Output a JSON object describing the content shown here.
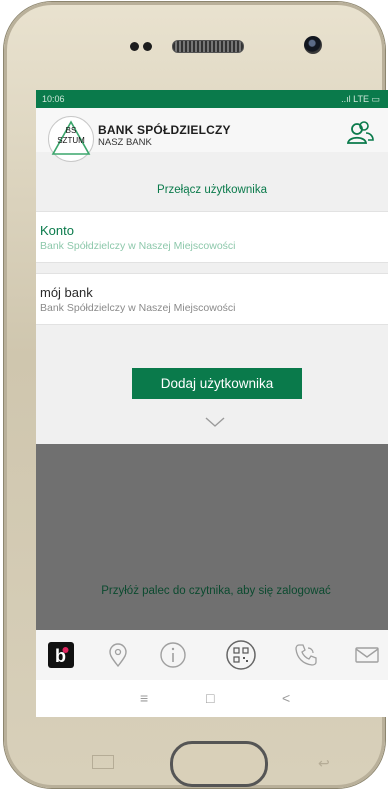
{
  "status": {
    "time": "10:06",
    "right": "..ıl LTE ▭"
  },
  "brand": {
    "logo_line1": "BS",
    "logo_line2": "SZTUM",
    "name": "BANK SPÓŁDZIELCZY",
    "sub": "NASZ BANK"
  },
  "switch_title": "Przełącz użytkownika",
  "accounts": [
    {
      "name": "Konto",
      "bank": "Bank Spółdzielczy w Naszej Miejscowości"
    },
    {
      "name": "mój bank",
      "bank": "Bank Spółdzielczy w Naszej Miejscowości"
    }
  ],
  "add_button": "Dodaj użytkownika",
  "fingerprint_text": "Przyłóż palec do czytnika, aby się zalogować",
  "icons": {
    "users": "users-icon",
    "blik": "b",
    "location": "map-pin-icon",
    "info": "info-icon",
    "qr": "qr-code-icon",
    "phone": "phone-icon",
    "mail": "mail-icon"
  },
  "nav": {
    "menu": "≡",
    "home": "□",
    "back": "<"
  },
  "colors": {
    "accent": "#0a7a4b",
    "grey": "#707070"
  }
}
